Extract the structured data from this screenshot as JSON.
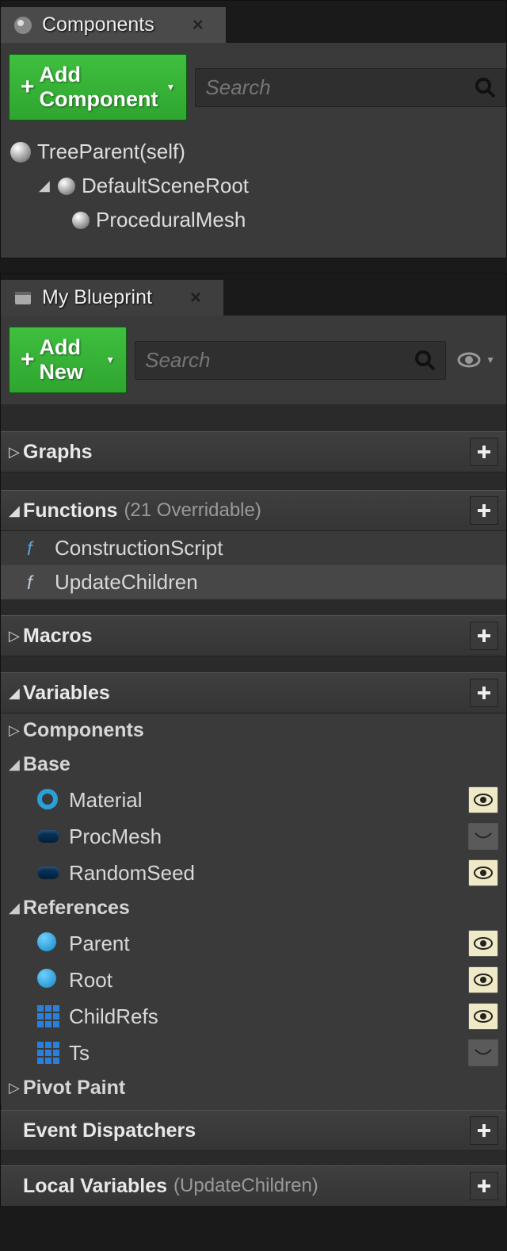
{
  "components_panel": {
    "tab_label": "Components",
    "add_button": "Add Component",
    "search_placeholder": "Search",
    "tree": {
      "root": "TreeParent(self)",
      "scene_root": "DefaultSceneRoot",
      "child": "ProceduralMesh"
    }
  },
  "blueprint_panel": {
    "tab_label": "My Blueprint",
    "add_button": "Add New",
    "search_placeholder": "Search",
    "sections": {
      "graphs": {
        "title": "Graphs"
      },
      "functions": {
        "title": "Functions",
        "note": "(21 Overridable)",
        "items": {
          "construction": "ConstructionScript",
          "update": "UpdateChildren"
        }
      },
      "macros": {
        "title": "Macros"
      },
      "variables": {
        "title": "Variables",
        "components_cat": "Components",
        "base_cat": "Base",
        "base_items": {
          "material": "Material",
          "procmesh": "ProcMesh",
          "randomseed": "RandomSeed"
        },
        "refs_cat": "References",
        "refs_items": {
          "parent": "Parent",
          "root": "Root",
          "childrefs": "ChildRefs",
          "ts": "Ts"
        },
        "pivot_cat": "Pivot Paint"
      },
      "dispatchers": {
        "title": "Event Dispatchers"
      },
      "localvars": {
        "title": "Local Variables",
        "note": "(UpdateChildren)"
      }
    }
  }
}
